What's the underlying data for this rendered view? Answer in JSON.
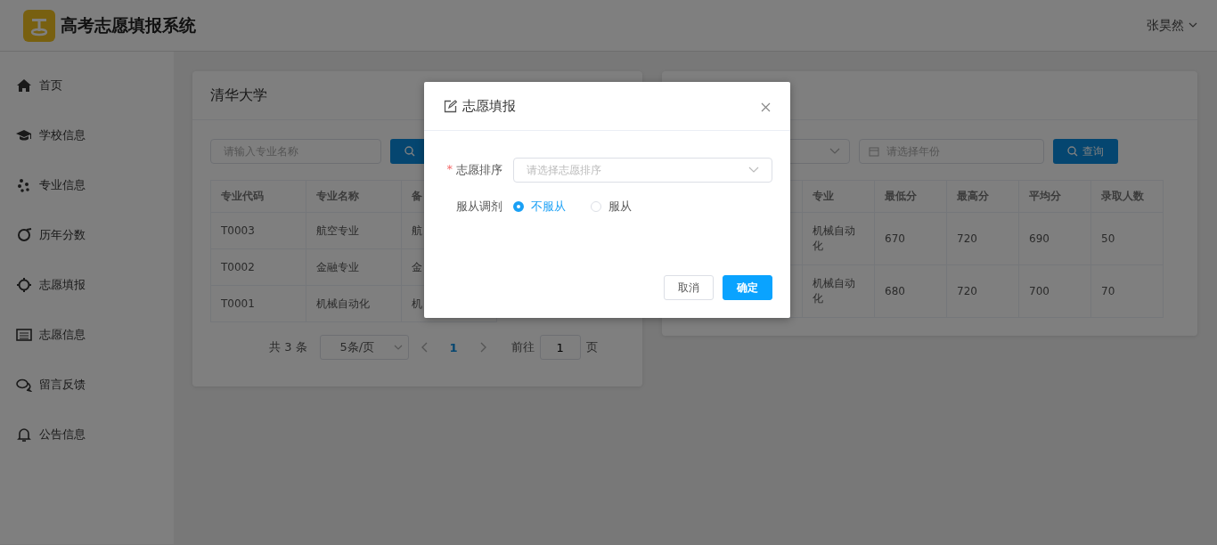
{
  "header": {
    "title": "高考志愿填报系统",
    "user": "张昊然"
  },
  "sidebar": {
    "items": [
      {
        "label": "首页"
      },
      {
        "label": "学校信息"
      },
      {
        "label": "专业信息"
      },
      {
        "label": "历年分数"
      },
      {
        "label": "志愿填报"
      },
      {
        "label": "志愿信息"
      },
      {
        "label": "留言反馈"
      },
      {
        "label": "公告信息"
      }
    ]
  },
  "major_card": {
    "title": "清华大学",
    "search": {
      "placeholder": "请输入专业名称"
    },
    "table": {
      "columns": [
        "专业代码",
        "专业名称",
        "备"
      ],
      "rows": [
        [
          "T0003",
          "航空专业",
          "航"
        ],
        [
          "T0002",
          "金融专业",
          "金"
        ],
        [
          "T0001",
          "机械自动化",
          "机"
        ]
      ]
    },
    "pagination": {
      "total": "共 3 条",
      "page_size": "5条/页",
      "pages": [
        {
          "label": "1",
          "selected": true
        }
      ],
      "goto_label": "前往",
      "goto_value": "1",
      "page_unit": "页"
    }
  },
  "score_card": {
    "year": {
      "placeholder": "请选择年份"
    },
    "search_button": "查询",
    "table": {
      "columns": [
        "专业",
        "最低分",
        "最高分",
        "平均分",
        "录取人数"
      ],
      "rows": [
        [
          "机械自动化",
          "670",
          "720",
          "690",
          "50"
        ],
        [
          "机械自动化",
          "680",
          "720",
          "700",
          "70"
        ]
      ]
    }
  },
  "dialog": {
    "title": "志愿填报",
    "fields": [
      {
        "kind": "select",
        "required_mark": "*",
        "label": "志愿排序",
        "placeholder": "请选择志愿排序"
      },
      {
        "kind": "radio",
        "label": "服从调剂",
        "options": [
          {
            "label": "不服从",
            "selected": true
          },
          {
            "label": "服从",
            "selected": false
          }
        ]
      }
    ],
    "buttons": [
      {
        "kind": "default",
        "label": "取消"
      },
      {
        "kind": "primary",
        "label": "确定"
      }
    ]
  }
}
